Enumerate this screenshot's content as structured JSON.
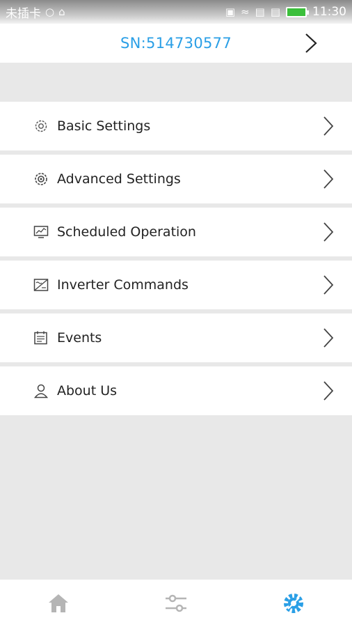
{
  "status_bar": {
    "carrier": "未插卡",
    "time": "11:30"
  },
  "header": {
    "serial": "SN:514730577"
  },
  "menu": {
    "items": [
      {
        "label": "Basic Settings",
        "icon": "gear-outline-icon"
      },
      {
        "label": "Advanced Settings",
        "icon": "gear-advanced-icon"
      },
      {
        "label": "Scheduled Operation",
        "icon": "monitor-chart-icon"
      },
      {
        "label": "Inverter Commands",
        "icon": "inverter-icon"
      },
      {
        "label": "Events",
        "icon": "calendar-icon"
      },
      {
        "label": "About Us",
        "icon": "person-icon"
      }
    ]
  },
  "tabs": {
    "items": [
      {
        "name": "home",
        "icon": "home-icon",
        "active": false
      },
      {
        "name": "controls",
        "icon": "sliders-icon",
        "active": false
      },
      {
        "name": "settings",
        "icon": "settings-gear-icon",
        "active": true
      }
    ],
    "active_color": "#2a9fe6",
    "inactive_color": "#b5b5b5"
  },
  "colors": {
    "accent": "#2a9fe6",
    "background": "#e8e8e8",
    "battery": "#3bbf3b"
  }
}
